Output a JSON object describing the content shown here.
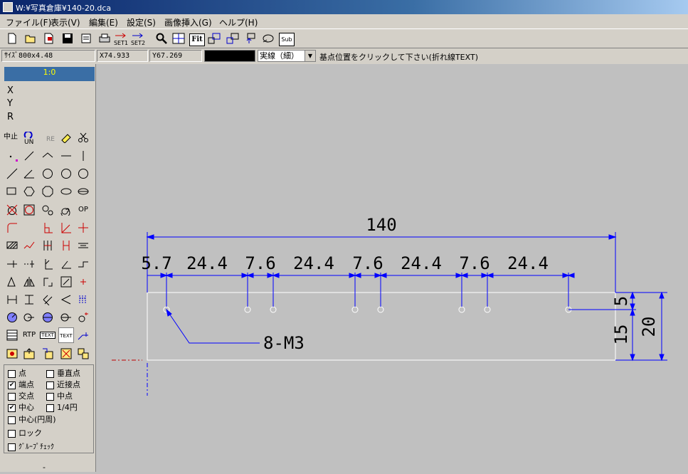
{
  "window": {
    "title": "W:¥写真倉庫¥140-20.dca"
  },
  "menu": [
    "ファイル(F)",
    "表示(V)",
    "編集(E)",
    "設定(S)",
    "画像挿入(G)",
    "ヘルプ(H)"
  ],
  "toolbar": {
    "set1": "SET1",
    "set2": "SET2",
    "fit": "Fit",
    "sub": "Sub"
  },
  "status": {
    "size": "ｻｲｽﾞ800x4.48",
    "x": "X74.933",
    "y": "Y67.269",
    "line_type": "実線（細）",
    "message": "基点位置をクリックして下さい(折れ線TEXT)"
  },
  "panel": {
    "scale": "1:0",
    "coords": [
      "X",
      "Y",
      "R"
    ],
    "cancel": "中止",
    "undo": "UN",
    "redo": "RE",
    "op": "OP",
    "rtp": "RTP",
    "text": "TEXT",
    "snaps": [
      {
        "label": "点",
        "checked": false
      },
      {
        "label": "垂直点",
        "checked": false
      },
      {
        "label": "端点",
        "checked": true
      },
      {
        "label": "近接点",
        "checked": false
      },
      {
        "label": "交点",
        "checked": false
      },
      {
        "label": "中点",
        "checked": false
      },
      {
        "label": "中心",
        "checked": true
      },
      {
        "label": "1/4円",
        "checked": false
      },
      {
        "label": "中心(円周)",
        "checked": false
      },
      {
        "label": "ロック",
        "checked": false
      },
      {
        "label": "ｸﾞﾙｰﾌﾟﾁｪｯｸ",
        "checked": false
      }
    ],
    "dash": "-"
  },
  "drawing": {
    "overall": "140",
    "spacings": [
      "5.7",
      "24.4",
      "7.6",
      "24.4",
      "7.6",
      "24.4",
      "7.6",
      "24.4"
    ],
    "leader": "8-M3",
    "dim5": "5",
    "dim15": "15",
    "dim20": "20"
  },
  "colors": {
    "dimension": "#0000ff",
    "canvas": "#c0c0c0",
    "part": "#ffffff"
  }
}
